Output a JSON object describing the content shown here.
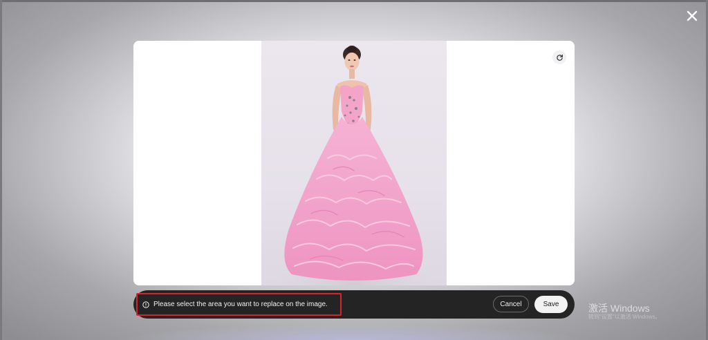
{
  "modal": {
    "close_icon": "close-icon"
  },
  "canvas": {
    "refresh_icon": "refresh-icon",
    "image_subject": "woman in pink ruffled ball gown"
  },
  "toolbar": {
    "hint_icon": "info-icon",
    "hint_text": "Please select the area you want to replace on the image.",
    "cancel_label": "Cancel",
    "save_label": "Save"
  },
  "os_watermark": {
    "title": "激活 Windows",
    "subtitle": "转到\"设置\"以激活 Windows。"
  },
  "colors": {
    "toolbar_bg": "#242424",
    "highlight_border": "#d9232d",
    "save_bg": "#f2f2f2",
    "dress_pink": "#f3a6cc"
  }
}
